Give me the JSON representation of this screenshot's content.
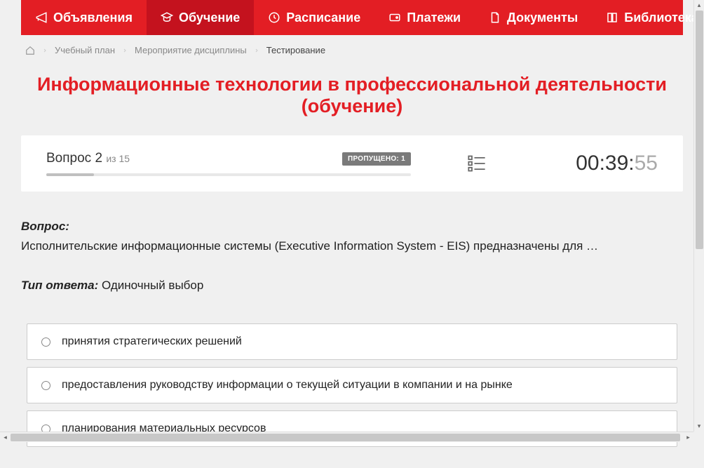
{
  "nav": {
    "items": [
      {
        "label": "Объявления",
        "icon": "megaphone"
      },
      {
        "label": "Обучение",
        "icon": "graduation",
        "active": true
      },
      {
        "label": "Расписание",
        "icon": "clock"
      },
      {
        "label": "Платежи",
        "icon": "wallet"
      },
      {
        "label": "Документы",
        "icon": "document"
      },
      {
        "label": "Библиотека",
        "icon": "book",
        "dropdown": true
      }
    ]
  },
  "breadcrumb": {
    "items": [
      {
        "label": "Учебный план"
      },
      {
        "label": "Мероприятие дисциплины"
      }
    ],
    "current": "Тестирование"
  },
  "page_title": "Информационные технологии в профессиональной деятельности (обучение)",
  "question_bar": {
    "question_word": "Вопрос",
    "question_num": "2",
    "total_prefix": "из",
    "total": "15",
    "skipped_label": "ПРОПУЩЕНО: 1",
    "timer_main": "00:39:",
    "timer_sec": "55"
  },
  "content": {
    "question_heading": "Вопрос:",
    "question_text": "Исполнительские информационные системы (Executive Information System - EIS) предназначены для …",
    "answer_type_label": "Тип ответа:",
    "answer_type_value": "Одиночный выбор",
    "answers": [
      "принятия стратегических решений",
      "предоставления руководству информации о текущей ситуации в компании и на рынке",
      "планирования материальных ресурсов"
    ]
  }
}
